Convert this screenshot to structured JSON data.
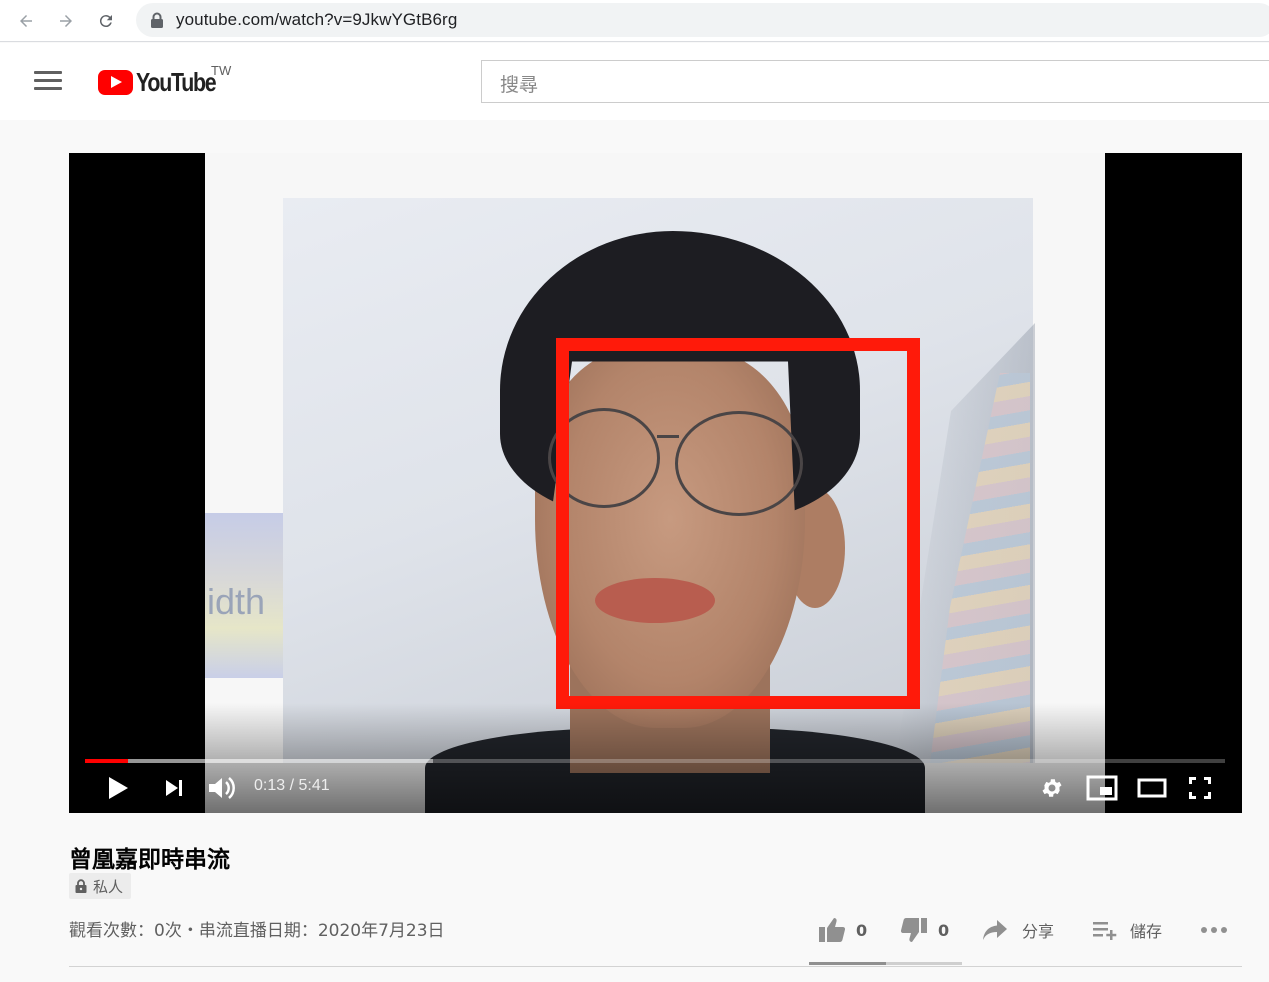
{
  "browser": {
    "url": "youtube.com/watch?v=9JkwYGtB6rg"
  },
  "header": {
    "logo_text": "YouTube",
    "region": "TW",
    "search_placeholder": "搜尋"
  },
  "player": {
    "time_display": "0:13 / 5:41",
    "progress_played_percent": 3.8,
    "progress_buffered_percent": 30.5,
    "poster_text": "idth"
  },
  "video": {
    "title": "曾凰嘉即時串流",
    "privacy_label": "私人",
    "meta": "觀看次數：0次・串流直播日期：2020年7月23日",
    "like_count": "0",
    "dislike_count": "0",
    "share_label": "分享",
    "save_label": "儲存"
  },
  "colors": {
    "brand_red": "#ff0000",
    "detection_box": "#ff1a0a"
  }
}
